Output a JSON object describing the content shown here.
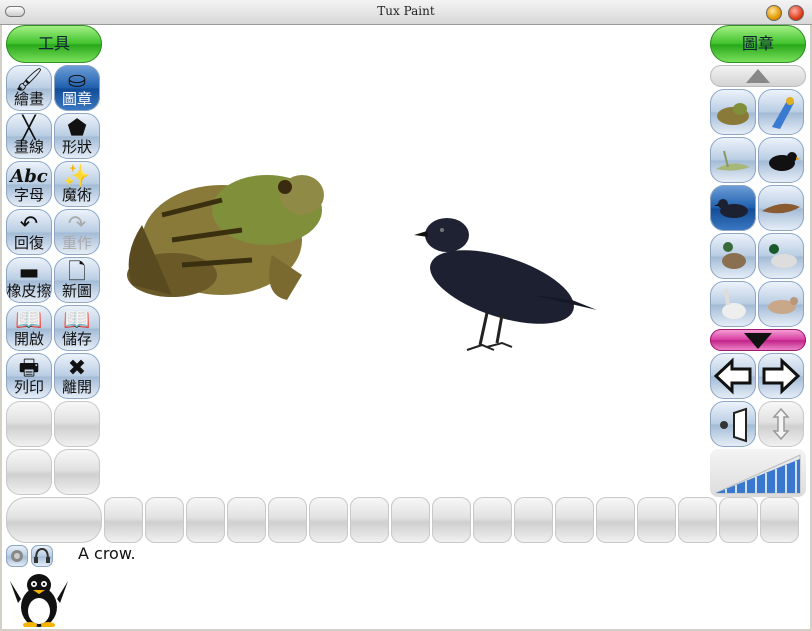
{
  "window": {
    "title": "Tux Paint"
  },
  "tools_header": "工具",
  "stamps_header": "圖章",
  "tools": [
    {
      "label": "繪畫",
      "icon": "paint-brush-icon",
      "glyph": "🖌",
      "selected": false,
      "disabled": false
    },
    {
      "label": "圖章",
      "icon": "stamp-icon",
      "glyph": "⛀",
      "selected": true,
      "disabled": false
    },
    {
      "label": "畫線",
      "icon": "lines-icon",
      "glyph": "╳",
      "selected": false,
      "disabled": false
    },
    {
      "label": "形狀",
      "icon": "pentagon-icon",
      "glyph": "⬟",
      "selected": false,
      "disabled": false
    },
    {
      "label": "字母",
      "icon": "text-abc-icon",
      "glyph": "Abc",
      "selected": false,
      "disabled": false
    },
    {
      "label": "魔術",
      "icon": "magic-wand-icon",
      "glyph": "✨",
      "selected": false,
      "disabled": false
    },
    {
      "label": "回復",
      "icon": "undo-icon",
      "glyph": "↶",
      "selected": false,
      "disabled": false
    },
    {
      "label": "重作",
      "icon": "redo-icon",
      "glyph": "↷",
      "selected": false,
      "disabled": true
    },
    {
      "label": "橡皮擦",
      "icon": "eraser-icon",
      "glyph": "▬",
      "selected": false,
      "disabled": false
    },
    {
      "label": "新圖",
      "icon": "new-page-icon",
      "glyph": "🗋",
      "selected": false,
      "disabled": false
    },
    {
      "label": "開啟",
      "icon": "open-book-icon",
      "glyph": "📖",
      "selected": false,
      "disabled": false
    },
    {
      "label": "儲存",
      "icon": "save-book-icon",
      "glyph": "📖",
      "selected": false,
      "disabled": false
    },
    {
      "label": "列印",
      "icon": "printer-icon",
      "glyph": "🖶",
      "selected": false,
      "disabled": false
    },
    {
      "label": "離開",
      "icon": "quit-x-icon",
      "glyph": "✖",
      "selected": false,
      "disabled": false
    }
  ],
  "stamps": [
    {
      "name": "frog",
      "icon": "frog-stamp-icon",
      "selected": false
    },
    {
      "name": "parrot",
      "icon": "parrot-stamp-icon",
      "selected": false
    },
    {
      "name": "lizard",
      "icon": "lizard-stamp-icon",
      "selected": false
    },
    {
      "name": "blackbird",
      "icon": "blackbird-stamp-icon",
      "selected": false
    },
    {
      "name": "crow",
      "icon": "crow-stamp-icon",
      "selected": true
    },
    {
      "name": "hawk",
      "icon": "hawk-stamp-icon",
      "selected": false
    },
    {
      "name": "duck",
      "icon": "duck-stamp-icon",
      "selected": false
    },
    {
      "name": "mallard",
      "icon": "mallard-stamp-icon",
      "selected": false
    },
    {
      "name": "goose",
      "icon": "goose-stamp-icon",
      "selected": false
    },
    {
      "name": "bird",
      "icon": "bird-stamp-icon",
      "selected": false
    }
  ],
  "message": "A crow.",
  "colors": {
    "tool_blue": "#a3bbd6",
    "selected_blue": "#1f5fae",
    "green": "#3fc12b",
    "magenta": "#d63aa0"
  }
}
